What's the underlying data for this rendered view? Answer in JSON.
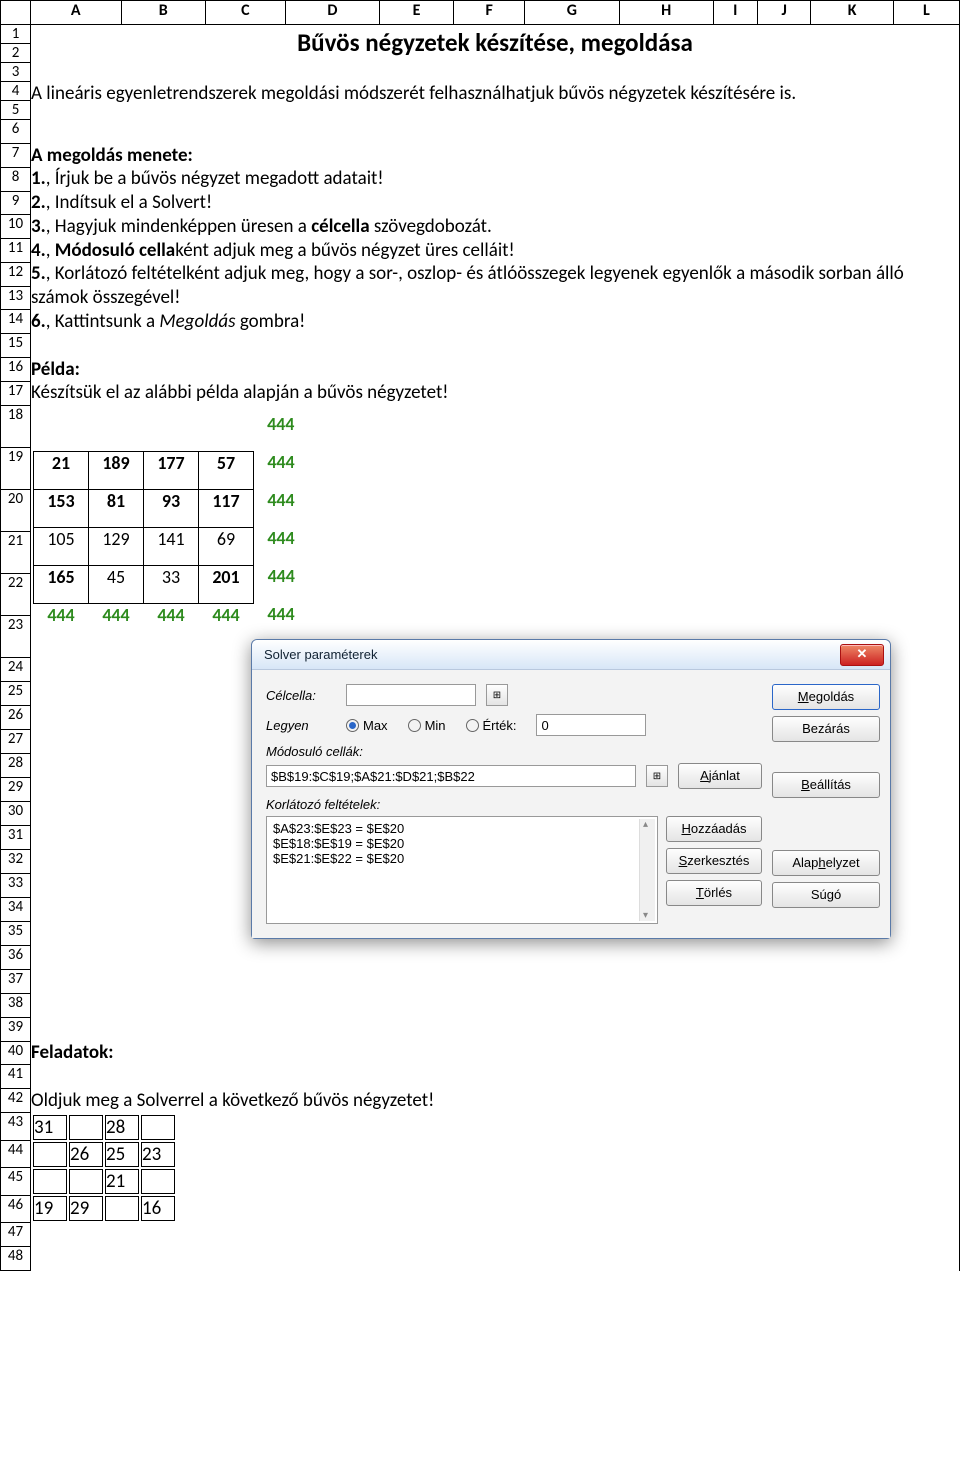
{
  "columns": [
    "A",
    "B",
    "C",
    "D",
    "E",
    "F",
    "G",
    "H",
    "I",
    "J",
    "K",
    "L"
  ],
  "rows_count": 48,
  "title": "Bűvös négyzetek készítése, megoldása",
  "intro": "A lineáris egyenletrendszerek megoldási módszerét felhasználhatjuk bűvös négyzetek készítésére is.",
  "steps_header": "A megoldás menete:",
  "steps": {
    "s1a": "1.",
    "s1b": ", Írjuk be a bűvös négyzet megadott adatait!",
    "s2a": "2.",
    "s2b": ", Indítsuk el a Solvert!",
    "s3a": "3.",
    "s3b1": ", Hagyjuk mindenképpen üresen a ",
    "s3_bold": "célcella",
    "s3b2": " szövegdobozát.",
    "s4a": "4.",
    "s4b1": ", ",
    "s4_bold": "Módosuló cella",
    "s4b2": "ként adjuk meg a bűvös négyzet üres celláit!",
    "s5a": "5.",
    "s5b": ", Korlátozó feltételként adjuk meg, hogy a sor-, oszlop- és átlóösszegek legyenek egyenlők a második sorban álló számok összegével!",
    "s6a": "6.",
    "s6b1": ", Kattintsunk a ",
    "s6_italic": "Megoldás",
    "s6b2": " gombra!"
  },
  "example_label": "Példa:",
  "example_text": "Készítsük el az alábbi példa alapján a bűvös négyzetet!",
  "magic": {
    "diag_top": "444",
    "rows": [
      {
        "cells": [
          "21",
          "189",
          "177",
          "57"
        ],
        "sum": "444",
        "bold": [
          true,
          true,
          true,
          true
        ]
      },
      {
        "cells": [
          "153",
          "81",
          "93",
          "117"
        ],
        "sum": "444",
        "bold": [
          true,
          true,
          true,
          true
        ]
      },
      {
        "cells": [
          "105",
          "129",
          "141",
          "69"
        ],
        "sum": "444",
        "bold": [
          false,
          false,
          false,
          false
        ]
      },
      {
        "cells": [
          "165",
          "45",
          "33",
          "201"
        ],
        "sum": "444",
        "bold": [
          true,
          false,
          false,
          true
        ]
      }
    ],
    "col_sums": [
      "444",
      "444",
      "444",
      "444",
      "444"
    ]
  },
  "solver": {
    "title": "Solver paraméterek",
    "labels": {
      "celcella": "Célcella:",
      "legyen": "Legyen",
      "max": "Max",
      "min": "Min",
      "ertek": "Érték:",
      "ertek_val": "0",
      "modosulo": "Módosuló cellák:",
      "modosulo_val": "$B$19:$C$19;$A$21:$D$21;$B$22",
      "korlatozo": "Korlátozó feltételek:",
      "constraints": [
        "$A$23:$E$23 = $E$20",
        "$E$18:$E$19 = $E$20",
        "$E$21:$E$22 = $E$20"
      ]
    },
    "buttons": {
      "megoldas": "Megoldás",
      "bezaras": "Bezárás",
      "ajanlat": "Ajánlat",
      "beallitas": "Beállítás",
      "hozzaadas": "Hozzáadás",
      "szerkesztes": "Szerkesztés",
      "torles": "Törlés",
      "alaphelyzet": "Alaphelyzet",
      "sugo": "Súgó"
    }
  },
  "tasks_header": "Feladatok:",
  "tasks_text": "Oldjuk meg a Solverrel a következő bűvös négyzetet!",
  "task_grid": [
    [
      "31",
      "",
      "28",
      ""
    ],
    [
      "",
      "26",
      "25",
      "23"
    ],
    [
      "",
      "",
      "21",
      ""
    ],
    [
      "19",
      "29",
      "",
      "16"
    ]
  ]
}
